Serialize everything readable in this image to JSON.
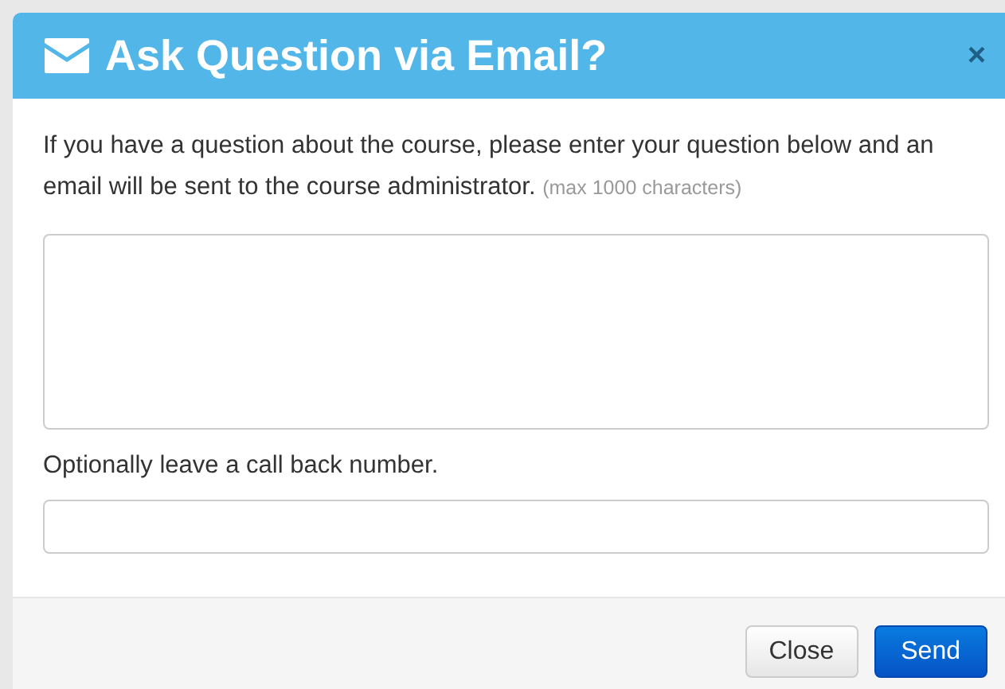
{
  "dialog": {
    "title": "Ask Question via Email?",
    "close_symbol": "×",
    "intro": "If you have a question about the course, please enter your question below and an email will be sent to the course administrator.",
    "hint": "(max 1000 characters)",
    "callback_label": "Optionally leave a call back number.",
    "buttons": [
      {
        "label": "Close",
        "kind": "default"
      },
      {
        "label": "Send",
        "kind": "primary"
      }
    ]
  }
}
